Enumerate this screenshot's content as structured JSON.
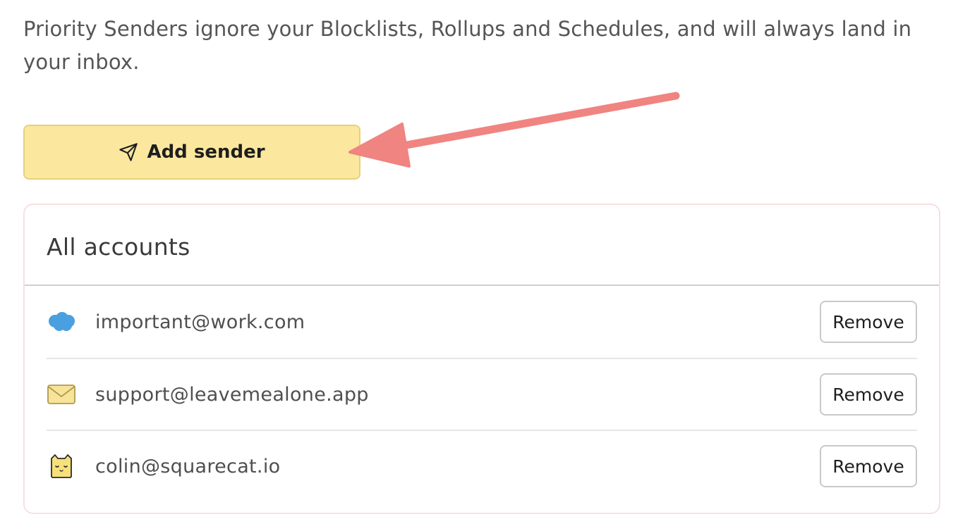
{
  "intro_text": "Priority Senders ignore your Blocklists, Rollups and Schedules, and will always land in your inbox.",
  "add_button": {
    "label": "Add sender",
    "icon": "send-icon"
  },
  "annotation_arrow_color": "#f08480",
  "card": {
    "title": "All accounts",
    "rows": [
      {
        "email": "important@work.com",
        "icon": "salesforce-cloud-icon",
        "remove_label": "Remove"
      },
      {
        "email": "support@leavemealone.app",
        "icon": "envelope-icon",
        "remove_label": "Remove"
      },
      {
        "email": "colin@squarecat.io",
        "icon": "squarecat-icon",
        "remove_label": "Remove"
      }
    ]
  },
  "colors": {
    "add_button_bg": "#fce79f",
    "card_border": "#f8dfe2",
    "cloud_blue": "#4a9fe0",
    "envelope_yellow": "#f7e39a"
  }
}
